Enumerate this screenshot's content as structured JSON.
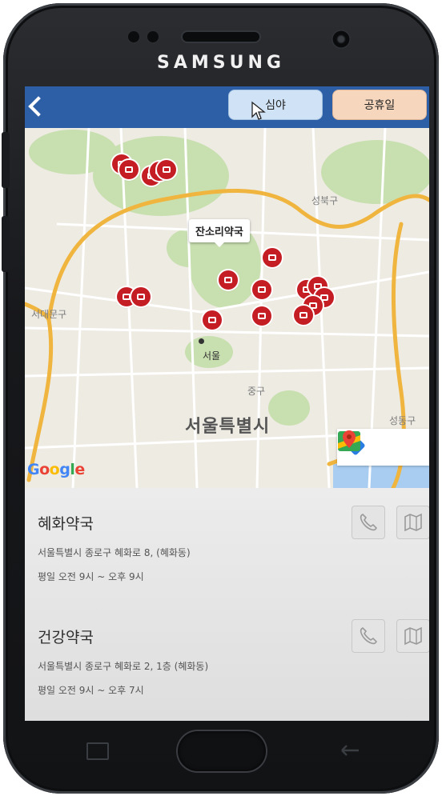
{
  "device": {
    "brand": "SAMSUNG"
  },
  "appbar": {
    "night_label": "심야",
    "holiday_label": "공휴일"
  },
  "map": {
    "callout": "잔소리약국",
    "labels": {
      "seongbuk": "성북구",
      "seodaemun": "서대문구",
      "seoul": "서울",
      "jung": "중구",
      "seoul_city": "서울특별시",
      "seongdong": "성동구"
    },
    "attribution": "Google",
    "colors": {
      "pin": "#c51d24",
      "road_major": "#f0b53f",
      "park": "#c8dfb0",
      "water": "#a9cdf0"
    }
  },
  "pharmacies": [
    {
      "name": "혜화약국",
      "address": "서울특별시 종로구 혜화로 8, (혜화동)",
      "hours": "평일 오전 9시 ~ 오후 9시"
    },
    {
      "name": "건강약국",
      "address": "서울특별시 종로구 혜화로 2, 1층 (혜화동)",
      "hours": "평일 오전 9시 ~ 오후 7시"
    }
  ],
  "colors": {
    "appbar": "#2d5fa6",
    "night_button": "#d0e3f6",
    "holiday_button": "#f6d7bd"
  }
}
